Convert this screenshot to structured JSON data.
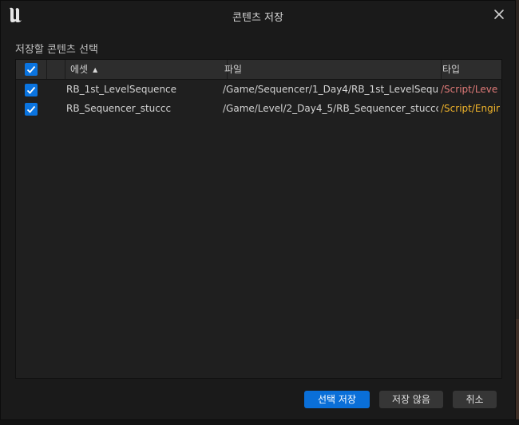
{
  "window": {
    "title": "콘텐츠 저장",
    "section_label": "저장할 콘텐츠 선택"
  },
  "table": {
    "columns": {
      "asset": "에셋",
      "path": "파일",
      "type": "타입"
    },
    "header_checked": true,
    "rows": [
      {
        "checked": true,
        "asset": "RB_1st_LevelSequence",
        "path": "/Game/Sequencer/1_Day4/RB_1st_LevelSeque",
        "type": "/Script/Leve",
        "type_color": "#e07a78"
      },
      {
        "checked": true,
        "asset": "RB_Sequencer_stuccc",
        "path": "/Game/Level/2_Day4_5/RB_Sequencer_stuccc",
        "type": "/Script/Engir",
        "type_color": "#f0b42a"
      }
    ]
  },
  "buttons": {
    "save_selected": "선택 저장",
    "dont_save": "저장 않음",
    "cancel": "취소"
  },
  "colors": {
    "accent": "#0a74e0",
    "background": "#1a1a1a"
  },
  "icons": {
    "logo": "unreal-engine-logo-icon",
    "close": "close-icon",
    "check": "checkmark-icon",
    "sort": "sort-ascending-icon"
  }
}
